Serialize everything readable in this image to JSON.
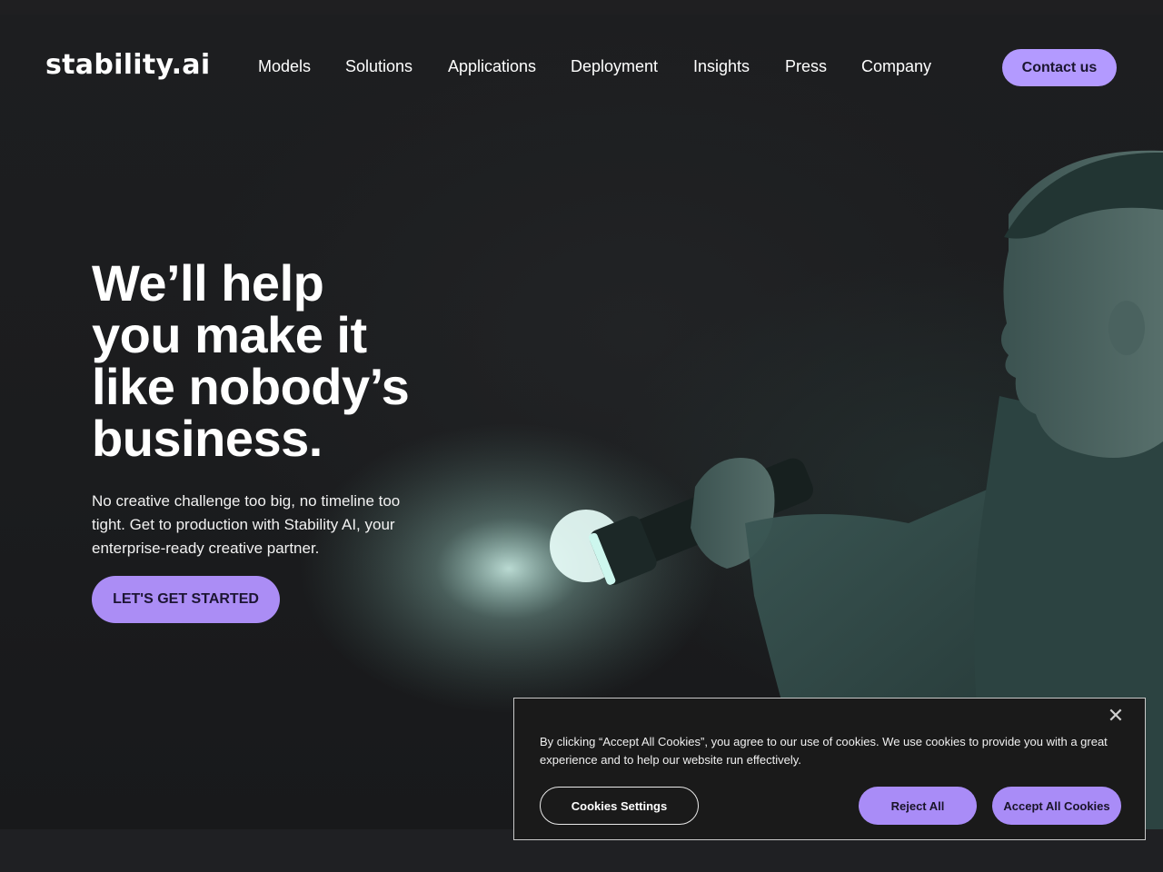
{
  "header": {
    "logo": "stability.ai",
    "nav": [
      {
        "label": "Models"
      },
      {
        "label": "Solutions"
      },
      {
        "label": "Applications"
      },
      {
        "label": "Deployment"
      },
      {
        "label": "Insights"
      },
      {
        "label": "Press"
      },
      {
        "label": "Company"
      }
    ],
    "contact_label": "Contact us"
  },
  "hero": {
    "headline_lines": [
      "We’ll help",
      "you make it",
      "like nobody’s",
      "business."
    ],
    "subtext": "No creative challenge too big, no timeline too tight. Get to production with Stability AI, your enterprise-ready creative partner.",
    "cta_label": "LET'S GET STARTED",
    "image_description_icon": "person-with-flashlight-illustration"
  },
  "cookie_banner": {
    "text": "By clicking “Accept All Cookies”, you agree to our use of cookies. We use cookies to provide you with a great experience and to help our website run effectively.",
    "close_glyph": "✕",
    "settings_label": "Cookies Settings",
    "reject_label": "Reject All",
    "accept_label": "Accept All Cookies"
  },
  "colors": {
    "accent": "#b39aff",
    "background": "#1b1c1e",
    "cookie_bg": "#1a1a1a"
  }
}
